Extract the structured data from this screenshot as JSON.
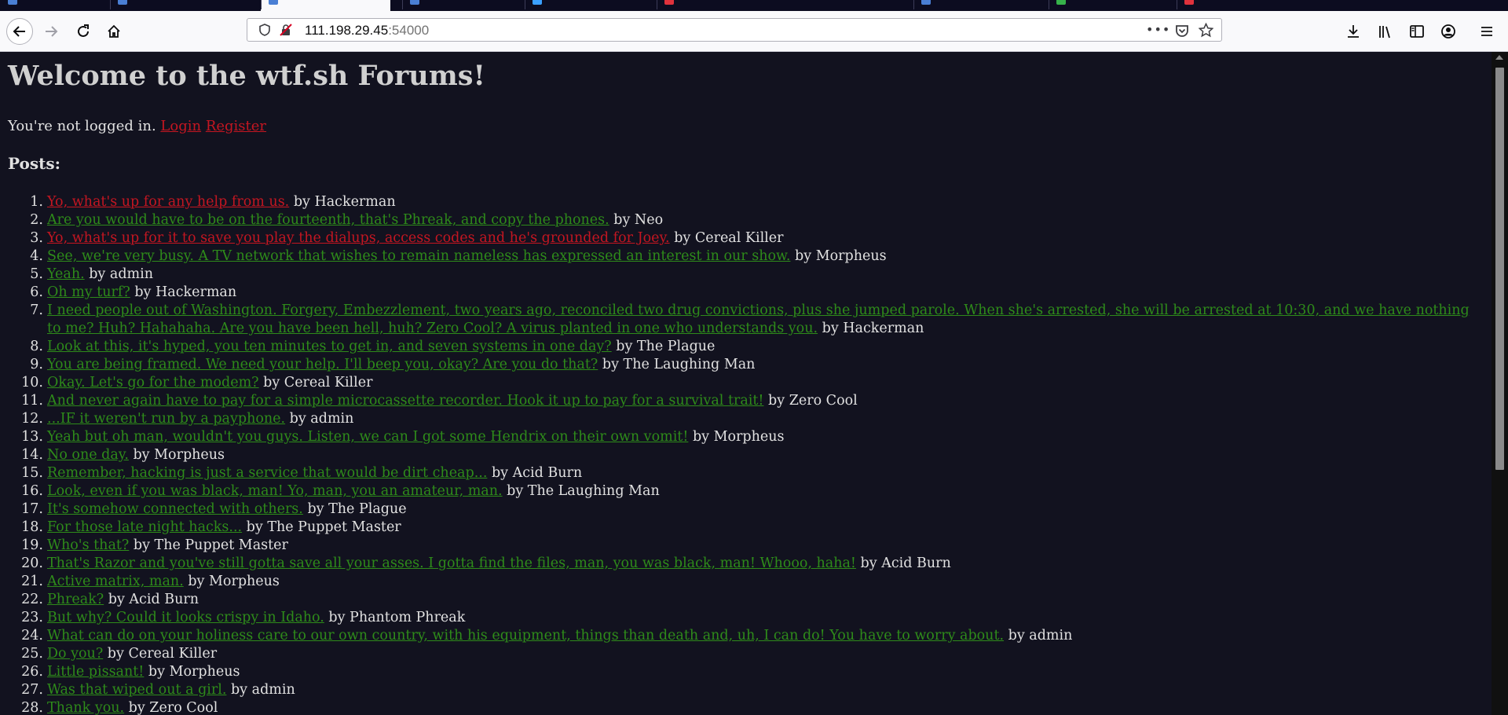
{
  "tabs": [
    {
      "label": "",
      "fav": "#4a7fd4",
      "icon": "document-icon"
    },
    {
      "label": "",
      "fav": "#4a7fd4",
      "icon": "document-icon"
    },
    {
      "label": "",
      "fav": "#4a7fd4",
      "icon": "document-icon",
      "active": true
    },
    {
      "label": "",
      "fav": "#4a7fd4",
      "icon": "document-icon"
    },
    {
      "label": "",
      "fav": "#3aa0ff",
      "icon": "document-icon"
    },
    {
      "label": "",
      "fav": "#e0323c",
      "icon": "document-icon"
    },
    {
      "label": "",
      "fav": "#4a7fd4",
      "icon": "document-icon"
    },
    {
      "label": "",
      "fav": "#36b24a",
      "icon": "document-icon"
    },
    {
      "label": "",
      "fav": "#e0323c",
      "icon": "document-icon"
    }
  ],
  "navbar": {
    "url_host": "111.198.29.45",
    "url_port": ":54000",
    "icons": [
      "back-arrow-icon",
      "forward-arrow-icon",
      "reload-icon",
      "home-icon",
      "shield-icon",
      "insecure-lock-icon",
      "page-actions-icon",
      "pocket-icon",
      "bookmark-star-icon",
      "download-icon",
      "library-icon",
      "sidebar-icon",
      "account-icon",
      "menu-icon"
    ]
  },
  "page": {
    "title": "Welcome to the wtf.sh Forums!",
    "login_text": "You're not logged in.",
    "login_link": "Login",
    "register_link": "Register",
    "posts_heading": "Posts:",
    "posts": [
      {
        "num": "1.",
        "title": "Yo, what's up for any help from us.",
        "author": "by Hackerman",
        "visited": true
      },
      {
        "num": "2.",
        "title": "Are you would have to be on the fourteenth, that's Phreak, and copy the phones.",
        "author": "by Neo"
      },
      {
        "num": "3.",
        "title": "Yo, what's up for it to save you play the dialups, access codes and he's grounded for Joey.",
        "author": "by Cereal Killer",
        "visited": true
      },
      {
        "num": "4.",
        "title": "See, we're very busy. A TV network that wishes to remain nameless has expressed an interest in our show.",
        "author": "by Morpheus"
      },
      {
        "num": "5.",
        "title": "Yeah.",
        "author": "by admin"
      },
      {
        "num": "6.",
        "title": "Oh my turf?",
        "author": "by Hackerman"
      },
      {
        "num": "7.",
        "title": "I need people out of Washington. Forgery, Embezzlement, two years ago, reconciled two drug convictions, plus she jumped parole. When she's arrested, she will be arrested at 10:30, and we have nothing to me? Huh? Hahahaha. Are you have been hell, huh? Zero Cool? A virus planted in one who understands you.",
        "author": "by Hackerman",
        "wrap": true
      },
      {
        "num": "8.",
        "title": "Look at this, it's hyped, you ten minutes to get in, and seven systems in one day?",
        "author": "by The Plague"
      },
      {
        "num": "9.",
        "title": "You are being framed. We need your help. I'll beep you, okay? Are you do that?",
        "author": "by The Laughing Man"
      },
      {
        "num": "10.",
        "title": "Okay. Let's go for the modem?",
        "author": "by Cereal Killer"
      },
      {
        "num": "11.",
        "title": "And never again have to pay for a simple microcassette recorder. Hook it up to pay for a survival trait!",
        "author": "by Zero Cool"
      },
      {
        "num": "12.",
        "title": "...IF it weren't run by a payphone.",
        "author": "by admin"
      },
      {
        "num": "13.",
        "title": "Yeah but oh man, wouldn't you guys. Listen, we can I got some Hendrix on their own vomit!",
        "author": "by Morpheus"
      },
      {
        "num": "14.",
        "title": "No one day.",
        "author": "by Morpheus"
      },
      {
        "num": "15.",
        "title": "Remember, hacking is just a service that would be dirt cheap...",
        "author": "by Acid Burn"
      },
      {
        "num": "16.",
        "title": "Look, even if you was black, man! Yo, man, you an amateur, man.",
        "author": "by The Laughing Man"
      },
      {
        "num": "17.",
        "title": "It's somehow connected with others.",
        "author": "by The Plague"
      },
      {
        "num": "18.",
        "title": "For those late night hacks...",
        "author": "by The Puppet Master"
      },
      {
        "num": "19.",
        "title": "Who's that?",
        "author": "by The Puppet Master"
      },
      {
        "num": "20.",
        "title": "That's Razor and you've still gotta save all your asses. I gotta find the files, man, you was black, man! Whooo, haha!",
        "author": "by Acid Burn"
      },
      {
        "num": "21.",
        "title": "Active matrix, man.",
        "author": "by Morpheus"
      },
      {
        "num": "22.",
        "title": "Phreak?",
        "author": "by Acid Burn"
      },
      {
        "num": "23.",
        "title": "But why? Could it looks crispy in Idaho.",
        "author": "by Phantom Phreak"
      },
      {
        "num": "24.",
        "title": "What can do on your holiness care to our own country, with his equipment, things than death and, uh, I can do! You have to worry about.",
        "author": "by admin"
      },
      {
        "num": "25.",
        "title": "Do you?",
        "author": "by Cereal Killer"
      },
      {
        "num": "26.",
        "title": "Little pissant!",
        "author": "by Morpheus"
      },
      {
        "num": "27.",
        "title": "Was that wiped out a girl.",
        "author": "by admin"
      },
      {
        "num": "28.",
        "title": "Thank you.",
        "author": "by Zero Cool"
      }
    ]
  }
}
